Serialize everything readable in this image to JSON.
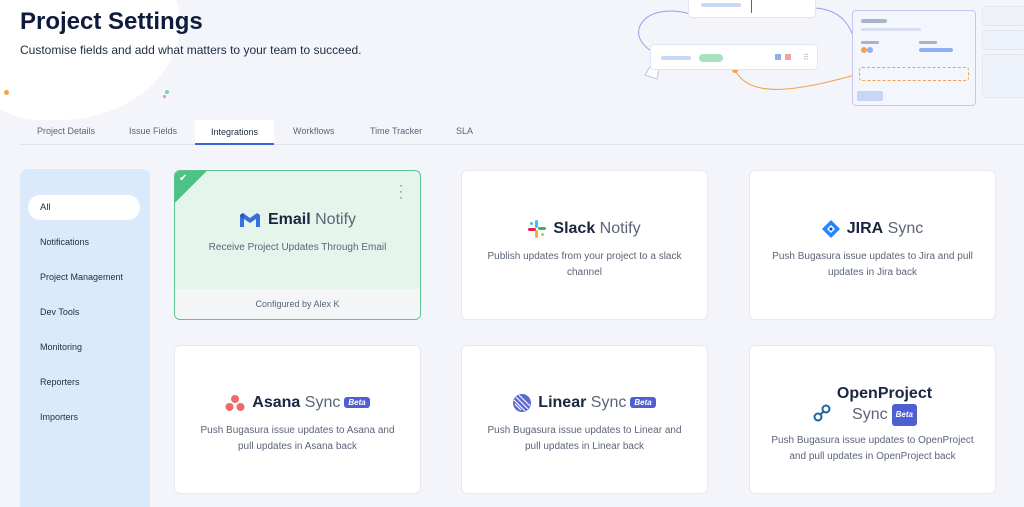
{
  "header": {
    "title": "Project Settings",
    "subtitle": "Customise fields and add what matters to your team to succeed."
  },
  "tabs": [
    {
      "label": "Project Details",
      "active": false
    },
    {
      "label": "Issue Fields",
      "active": false
    },
    {
      "label": "Integrations",
      "active": true
    },
    {
      "label": "Workflows",
      "active": false
    },
    {
      "label": "Time Tracker",
      "active": false
    },
    {
      "label": "SLA",
      "active": false
    }
  ],
  "sidebar": {
    "items": [
      {
        "label": "All",
        "active": true
      },
      {
        "label": "Notifications",
        "active": false
      },
      {
        "label": "Project Management",
        "active": false
      },
      {
        "label": "Dev Tools",
        "active": false
      },
      {
        "label": "Monitoring",
        "active": false
      },
      {
        "label": "Reporters",
        "active": false
      },
      {
        "label": "Importers",
        "active": false
      }
    ]
  },
  "cards": [
    {
      "brand": "Email",
      "type": "Notify",
      "description": "Receive Project Updates Through Email",
      "footer": "Configured by Alex K",
      "icon": "gmail-icon",
      "configured": true
    },
    {
      "brand": "Slack",
      "type": "Notify",
      "description": "Publish updates from your project to a slack channel",
      "icon": "slack-icon",
      "configured": false
    },
    {
      "brand": "JIRA",
      "type": "Sync",
      "description": "Push Bugasura issue updates to Jira and pull updates in Jira back",
      "icon": "jira-icon",
      "configured": false
    },
    {
      "brand": "Asana",
      "type": "Sync",
      "badge": "Beta",
      "description": "Push Bugasura issue updates to Asana and pull updates in Asana back",
      "icon": "asana-icon",
      "configured": false
    },
    {
      "brand": "Linear",
      "type": "Sync",
      "badge": "Beta",
      "description": "Push Bugasura issue updates to Linear and pull updates in Linear back",
      "icon": "linear-icon",
      "configured": false
    },
    {
      "brand": "OpenProject",
      "type": "Sync",
      "badge": "Beta",
      "description": "Push Bugasura issue updates to OpenProject and pull updates in OpenProject back",
      "icon": "openproject-icon",
      "configured": false
    }
  ],
  "colors": {
    "accent": "#3b63d8",
    "configured_border": "#5cc690",
    "configured_bg": "#e6f5ec",
    "beta_badge": "#4f5fd1",
    "sidebar_bg": "#dbeafb"
  }
}
